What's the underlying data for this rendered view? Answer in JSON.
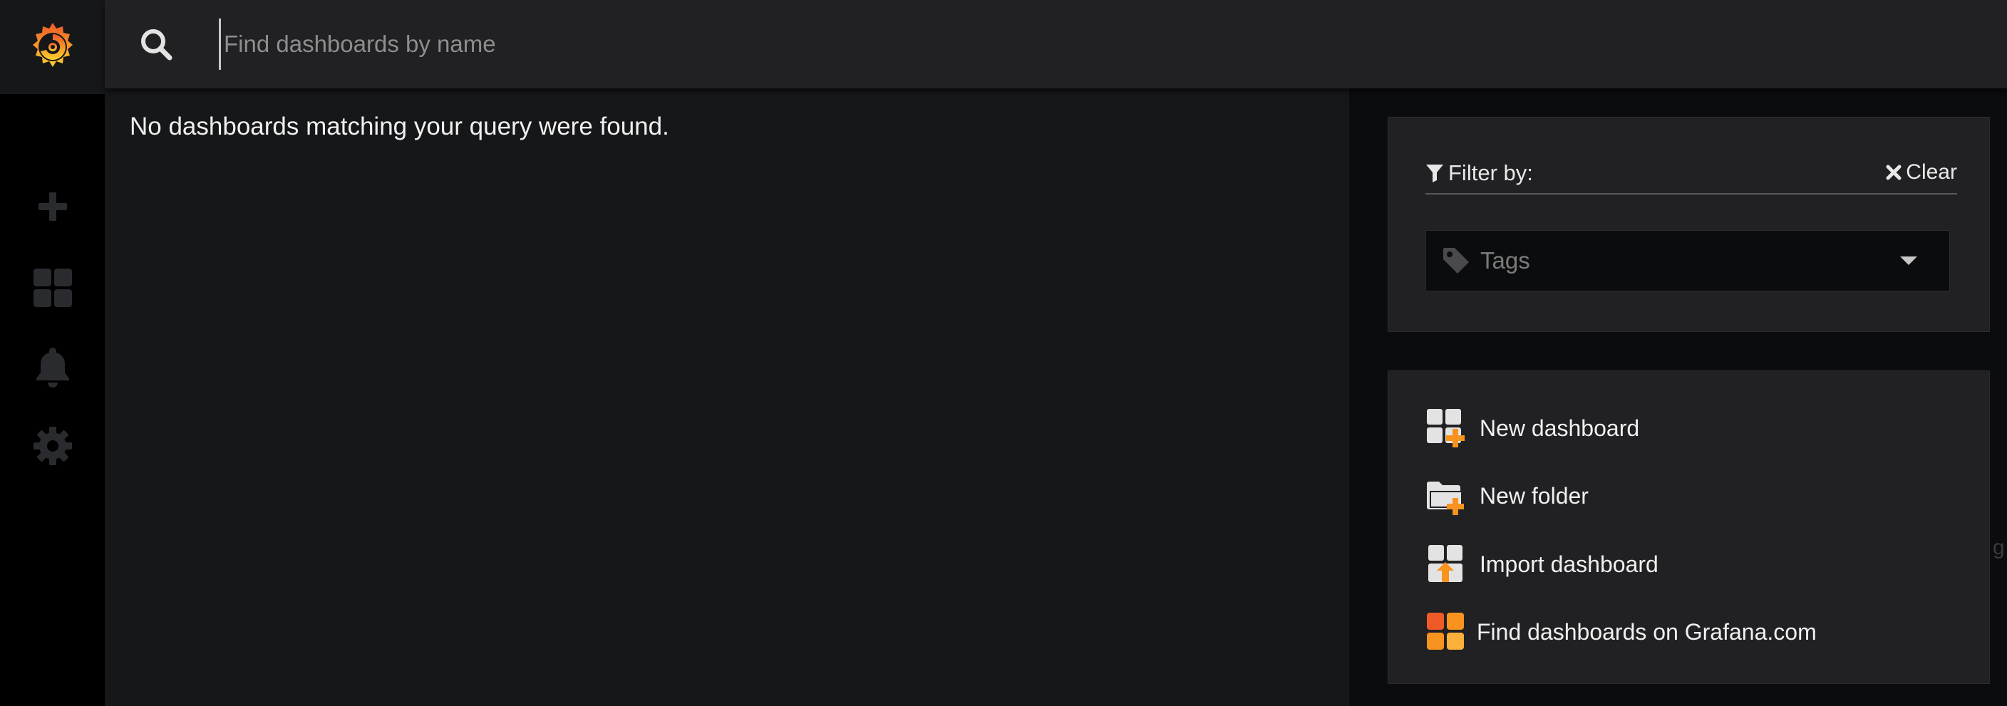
{
  "app": {
    "logo_icon": "grafana-logo-icon",
    "accent_color": "#f7931e"
  },
  "sidemenu": {
    "items": [
      {
        "name": "create",
        "icon": "plus-icon"
      },
      {
        "name": "dashboards",
        "icon": "apps-grid-icon"
      },
      {
        "name": "alerting",
        "icon": "bell-icon"
      },
      {
        "name": "configuration",
        "icon": "gear-icon"
      }
    ]
  },
  "search": {
    "placeholder": "Find dashboards by name",
    "value": "",
    "icon": "search-icon"
  },
  "results": {
    "empty_message": "No dashboards matching your query were found."
  },
  "filter": {
    "title": "Filter by:",
    "clear_label": "Clear",
    "tags_placeholder": "Tags"
  },
  "actions": {
    "items": [
      {
        "label": "New dashboard",
        "icon": "new-dashboard-icon"
      },
      {
        "label": "New folder",
        "icon": "new-folder-icon"
      },
      {
        "label": "Import dashboard",
        "icon": "import-dashboard-icon"
      },
      {
        "label": "Find dashboards on Grafana.com",
        "icon": "grafana-com-icon"
      }
    ]
  },
  "edge_fragment": "g"
}
